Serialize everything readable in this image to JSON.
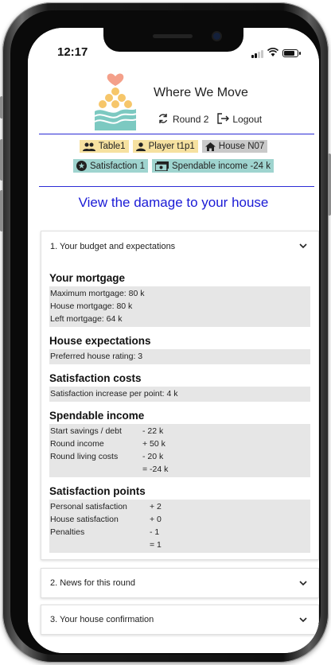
{
  "status_bar": {
    "time": "12:17"
  },
  "app": {
    "title": "Where We Move",
    "round_label": "Round 2",
    "logout_label": "Logout"
  },
  "tags": {
    "table": "Table1",
    "player": "Player t1p1",
    "house": "House N07",
    "satisfaction": "Satisfaction 1",
    "spendable": "Spendable income -24 k"
  },
  "colors": {
    "accent_blue": "#1a1ad6",
    "tag_yellow": "#f6e1a0",
    "tag_grey": "#c9c9c9",
    "tag_teal": "#9fd4cf"
  },
  "page_heading": "View the damage to your house",
  "accordion": [
    {
      "label": "1. Your budget and expectations",
      "expanded": true
    },
    {
      "label": "2. News for this round",
      "expanded": false
    },
    {
      "label": "3. Your house confirmation",
      "expanded": false
    }
  ],
  "budget": {
    "mortgage": {
      "title": "Your mortgage",
      "lines": [
        "Maximum mortgage: 80 k",
        "House mortgage: 80 k",
        "Left mortgage: 64 k"
      ]
    },
    "expectations": {
      "title": "House expectations",
      "lines": [
        "Preferred house rating: 3"
      ]
    },
    "satisfaction_costs": {
      "title": "Satisfaction costs",
      "lines": [
        "Satisfaction increase per point: 4 k"
      ]
    },
    "spendable_income": {
      "title": "Spendable income",
      "rows": [
        {
          "label": "Start savings / debt",
          "value": "- 22 k"
        },
        {
          "label": "Round income",
          "value": "+ 50 k"
        },
        {
          "label": "Round living costs",
          "value": "- 20 k"
        },
        {
          "label": "",
          "value": "= -24 k"
        }
      ]
    },
    "satisfaction_points": {
      "title": "Satisfaction points",
      "rows": [
        {
          "label": "Personal satisfaction",
          "value": "+ 2"
        },
        {
          "label": "House satisfaction",
          "value": "+ 0"
        },
        {
          "label": "Penalties",
          "value": "- 1"
        },
        {
          "label": "",
          "value": "= 1"
        }
      ]
    }
  }
}
